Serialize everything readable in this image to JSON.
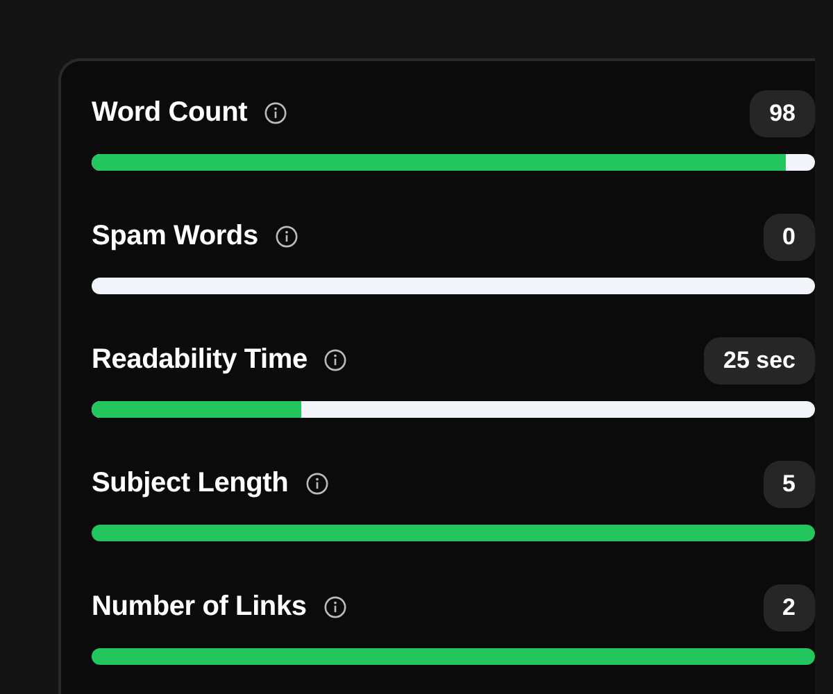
{
  "metrics": [
    {
      "label": "Word Count",
      "value": "98",
      "level": 0.96
    },
    {
      "label": "Spam Words",
      "value": "0",
      "level": 0
    },
    {
      "label": "Readability Time",
      "value": "25 sec",
      "level": 0.29
    },
    {
      "label": "Subject Length",
      "value": "5",
      "level": 1
    },
    {
      "label": "Number of Links",
      "value": "2",
      "level": 1
    }
  ]
}
